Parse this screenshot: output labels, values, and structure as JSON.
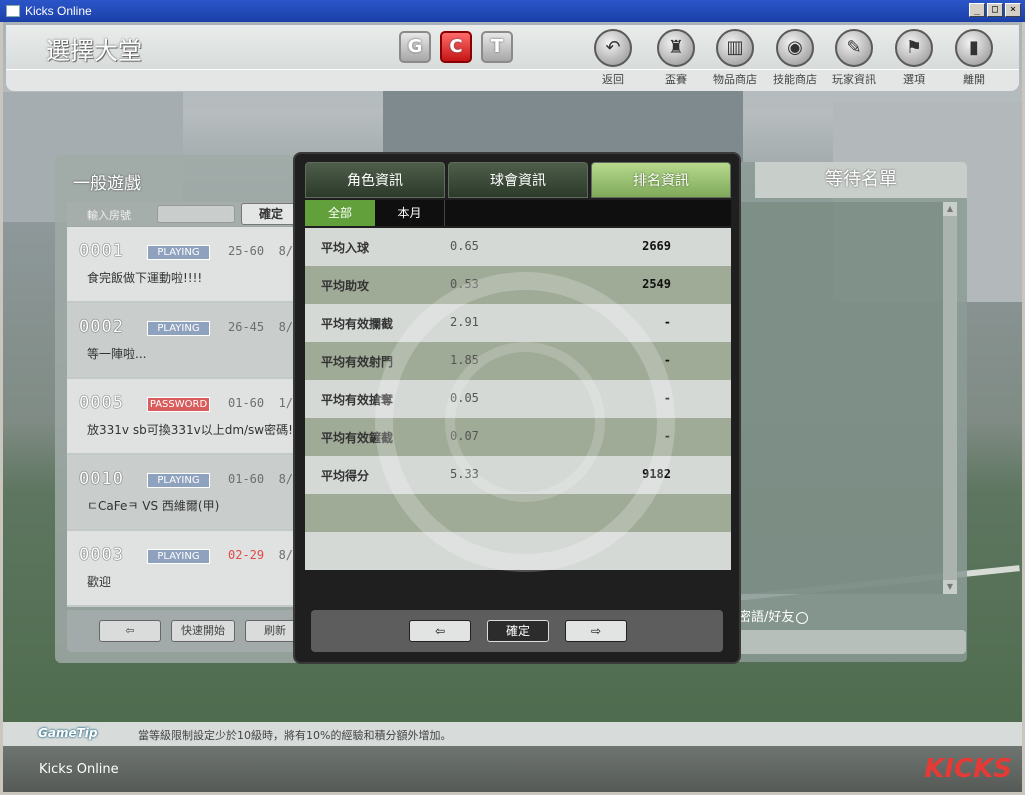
{
  "window": {
    "title": "Kicks Online",
    "min": "_",
    "max": "□",
    "close": "×"
  },
  "header": {
    "title": "選擇大堂",
    "mode_buttons": [
      "G",
      "C",
      "T"
    ],
    "nav": [
      {
        "label": "返回",
        "icon": "return-icon",
        "glyph": "↶"
      },
      {
        "label": "盃賽",
        "icon": "trophy-icon",
        "glyph": "♜"
      },
      {
        "label": "物品商店",
        "icon": "shop-icon",
        "glyph": "▥"
      },
      {
        "label": "技能商店",
        "icon": "skill-icon",
        "glyph": "◉"
      },
      {
        "label": "玩家資訊",
        "icon": "player-info-icon",
        "glyph": "✎"
      },
      {
        "label": "選項",
        "icon": "options-icon",
        "glyph": "⚑"
      },
      {
        "label": "離開",
        "icon": "exit-icon",
        "glyph": "▮"
      }
    ]
  },
  "lobby": {
    "title": "一般遊戲",
    "room_label": "輸入房號",
    "room_placeholder": "",
    "ok": "確定",
    "rooms": [
      {
        "num": "0001",
        "status": "PLAYING",
        "level": "25-60",
        "extra": "8/",
        "message": "食完飯做下運動啦!!!!"
      },
      {
        "num": "0002",
        "status": "PLAYING",
        "level": "26-45",
        "extra": "8/",
        "message": "等一陣啦..."
      },
      {
        "num": "0005",
        "status": "PASSWORD",
        "level": "01-60",
        "extra": "1/",
        "message": "放331v sb可換331v以上dm/sw密碼!"
      },
      {
        "num": "0010",
        "status": "PLAYING",
        "level": "01-60",
        "extra": "8/",
        "message": "ㄷCaFeㅋ VS 西維爾(甲)"
      },
      {
        "num": "0003",
        "status": "PLAYING",
        "level": "02-29",
        "extra": "8/",
        "message": "歡迎"
      }
    ],
    "footer": {
      "back": "⇦",
      "quick_start": "快速開始",
      "refresh": "刷新"
    }
  },
  "modal": {
    "tabs": [
      "角色資訊",
      "球會資訊",
      "排名資訊"
    ],
    "active_tab": 2,
    "subtabs": [
      "全部",
      "本月"
    ],
    "stats": [
      {
        "name": "平均入球",
        "value": "0.65",
        "rank": "2669"
      },
      {
        "name": "平均助攻",
        "value": "0.53",
        "rank": "2549"
      },
      {
        "name": "平均有效攔截",
        "value": "2.91",
        "rank": "-"
      },
      {
        "name": "平均有效射門",
        "value": "1.85",
        "rank": "-"
      },
      {
        "name": "平均有效搶奪",
        "value": "0.05",
        "rank": "-"
      },
      {
        "name": "平均有效鏟截",
        "value": "0.07",
        "rank": "-"
      },
      {
        "name": "平均得分",
        "value": "5.33",
        "rank": "9182"
      },
      {
        "name": "",
        "value": "",
        "rank": ""
      },
      {
        "name": "",
        "value": "",
        "rank": ""
      }
    ],
    "footer": {
      "prev": "⇦",
      "ok": "確定",
      "next": "⇨"
    }
  },
  "waiting": {
    "title": "等待名單",
    "chat": "密語/好友"
  },
  "gametip": {
    "logo": "GameTip",
    "text": "當等級限制設定少於10級時，將有10%的經驗和積分額外增加。"
  },
  "statusbar": {
    "app": "Kicks Online",
    "brand": "KICKS"
  },
  "colors": {
    "accent_green": "#7fa95a",
    "red": "#e53a35",
    "badge_playing": "#8ea2bd",
    "badge_password": "#d95c5c"
  }
}
